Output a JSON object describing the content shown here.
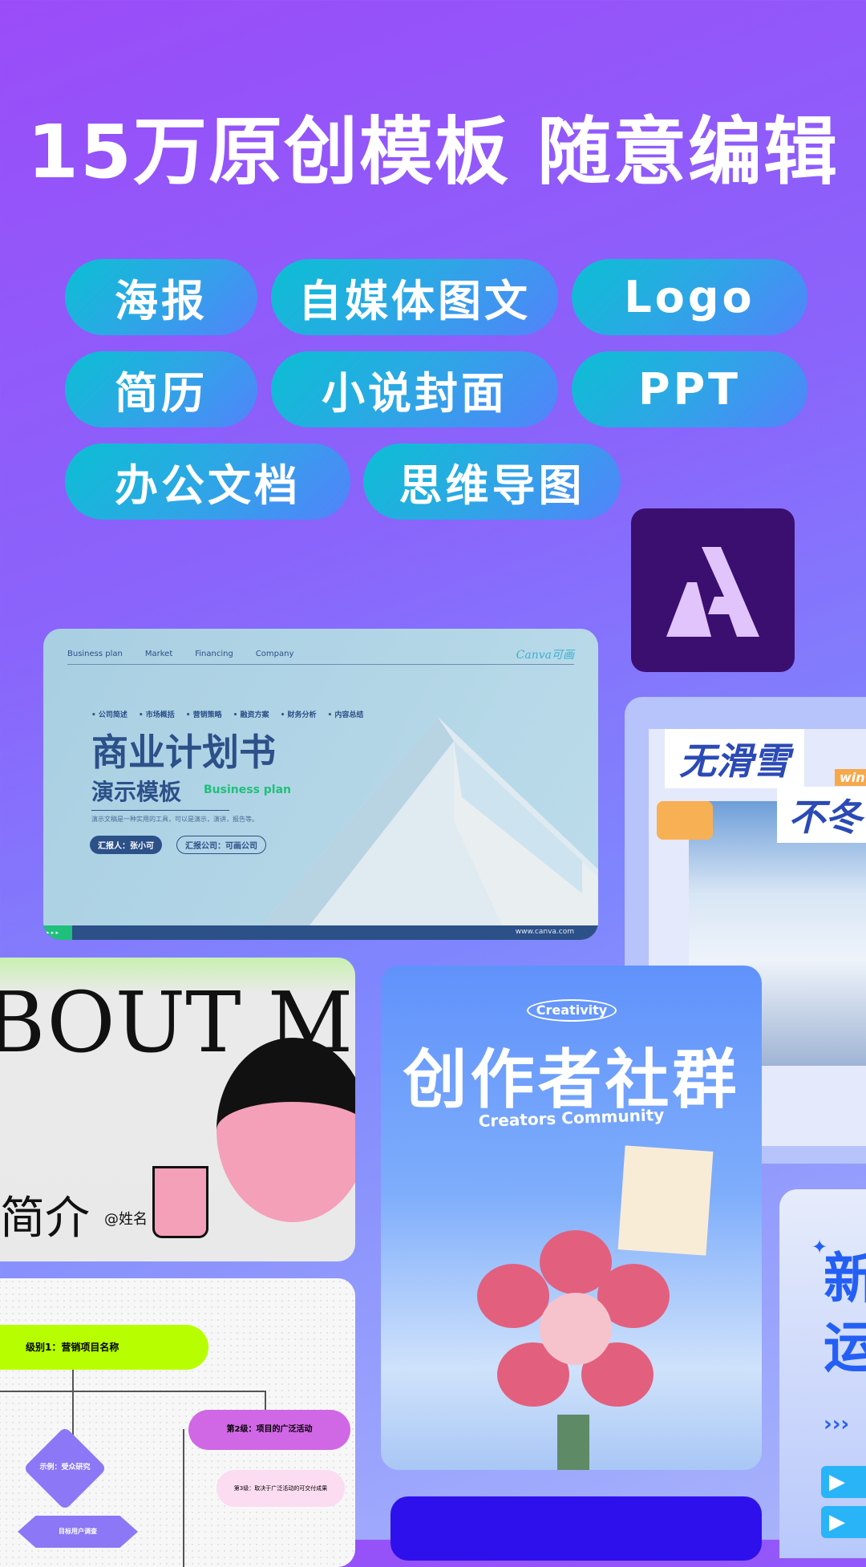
{
  "headline": "15万原创模板 随意编辑",
  "categories": [
    "海报",
    "自媒体图文",
    "Logo",
    "简历",
    "小说封面",
    "PPT",
    "办公文档",
    "思维导图"
  ],
  "app_logo": {
    "letter": "A",
    "bg": "#3b0f70",
    "fg": "#e0c4fb"
  },
  "colors": {
    "pill_start": "#0bbfd3",
    "pill_end": "#5283fb",
    "bg_top": "#9a4cf8",
    "bg_bottom": "#a9b4fb"
  },
  "business_card": {
    "nav": [
      "Business plan",
      "Market",
      "Financing",
      "Company"
    ],
    "brand": "Canva可画",
    "bullets": [
      "公司简述",
      "市场概括",
      "营销策略",
      "融资方案",
      "财务分析",
      "内容总结"
    ],
    "title": "商业计划书",
    "subtitle": "演示模板",
    "subtitle_en": "Business plan",
    "desc": "演示文稿是一种实用的工具，可以是演示，演讲，报告等。",
    "reporter": "汇报人：张小可",
    "company": "汇报公司：可画公司",
    "url": "www.canva.com"
  },
  "ski_card": {
    "line1": "无滑雪",
    "line2": "不冬",
    "tag": "win"
  },
  "about_card": {
    "title": "BOUT M",
    "cn": "简介",
    "name": "@姓名"
  },
  "creativity_card": {
    "badge": "Creativity",
    "title": "创作者社群",
    "subtitle": "Creators Community"
  },
  "flow_card": {
    "level1": "级别1：营销项目名称",
    "diamond": "示例：受众研究",
    "level2": "第2级：项目的广泛活动",
    "level3": "第3级：取决于广泛活动的可交付成果",
    "hex": "目标用户调查"
  },
  "xin_card": {
    "text": "新\n运",
    "arrows": "›››"
  }
}
